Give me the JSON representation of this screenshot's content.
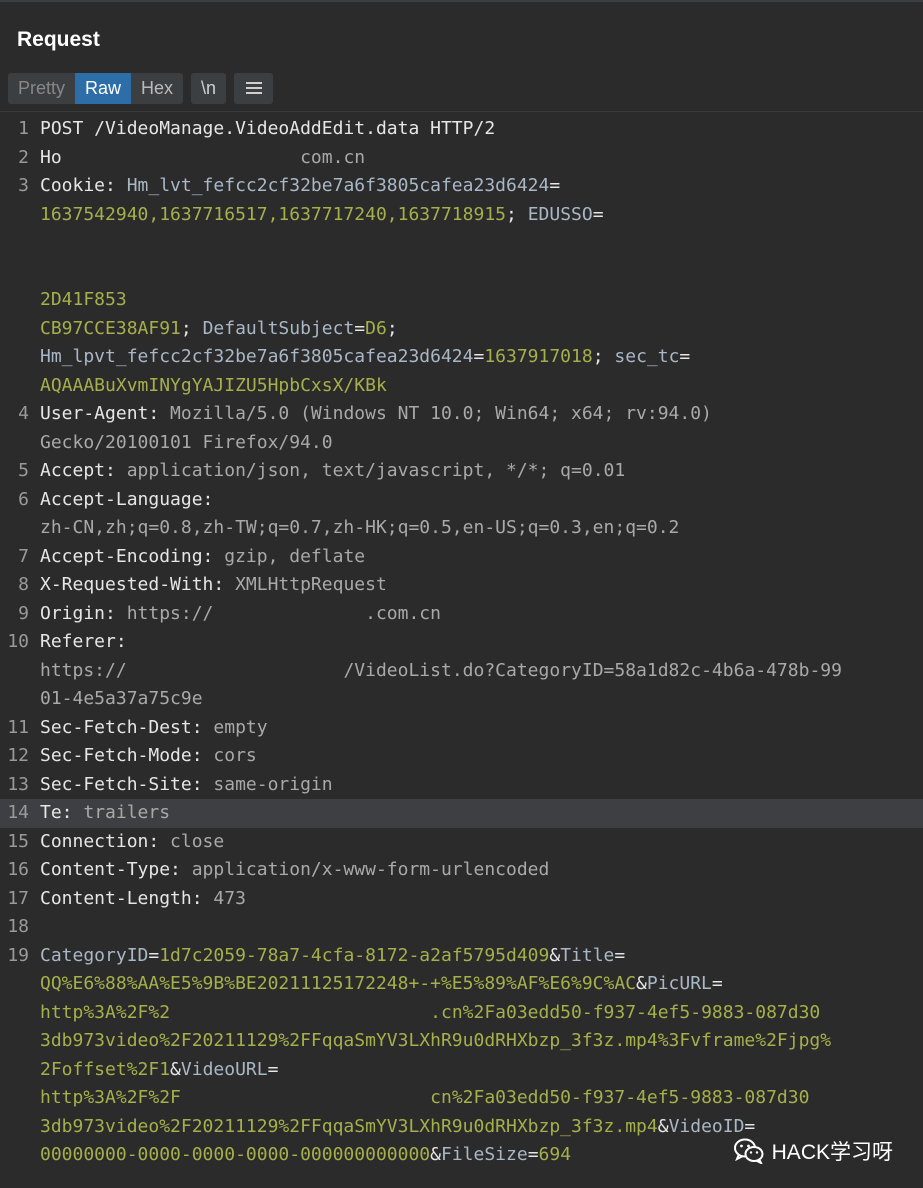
{
  "panel": {
    "title": "Request"
  },
  "toolbar": {
    "pretty_label": "Pretty",
    "raw_label": "Raw",
    "hex_label": "Hex",
    "newline_label": "\\n",
    "menu_icon": "hamburger-menu-icon"
  },
  "lines": [
    {
      "n": "1",
      "segs": [
        {
          "t": "POST /VideoManage.VideoAddEdit.data HTTP/2",
          "c": "k"
        }
      ]
    },
    {
      "n": "2",
      "segs": [
        {
          "t": "Ho",
          "c": "k"
        },
        {
          "t": "                      com.cn",
          "c": "v"
        }
      ]
    },
    {
      "n": "3",
      "segs": [
        {
          "t": "Cookie: ",
          "c": "k"
        },
        {
          "t": "Hm_lvt_fefcc2cf32be7a6f3805cafea23d6424",
          "c": "ck"
        },
        {
          "t": "=",
          "c": "k"
        }
      ]
    },
    {
      "n": "",
      "segs": [
        {
          "t": "1637542940,1637716517,1637717240,1637718915",
          "c": "cv"
        },
        {
          "t": "; ",
          "c": "k"
        },
        {
          "t": "EDUSSO",
          "c": "ck"
        },
        {
          "t": "=",
          "c": "k"
        }
      ]
    },
    {
      "n": "",
      "segs": [
        {
          "t": "",
          "c": "cv"
        }
      ]
    },
    {
      "n": "",
      "segs": [
        {
          "t": "",
          "c": "cv"
        }
      ]
    },
    {
      "n": "",
      "segs": [
        {
          "t": "2D41F853",
          "c": "cv"
        }
      ]
    },
    {
      "n": "",
      "segs": [
        {
          "t": "CB97CCE38AF91",
          "c": "cv"
        },
        {
          "t": "; ",
          "c": "k"
        },
        {
          "t": "DefaultSubject",
          "c": "ck"
        },
        {
          "t": "=",
          "c": "k"
        },
        {
          "t": "D6",
          "c": "cv"
        },
        {
          "t": ";",
          "c": "k"
        }
      ]
    },
    {
      "n": "",
      "segs": [
        {
          "t": "Hm_lpvt_fefcc2cf32be7a6f3805cafea23d6424",
          "c": "ck"
        },
        {
          "t": "=",
          "c": "k"
        },
        {
          "t": "1637917018",
          "c": "cv"
        },
        {
          "t": "; ",
          "c": "k"
        },
        {
          "t": "sec_tc",
          "c": "ck"
        },
        {
          "t": "=",
          "c": "k"
        }
      ]
    },
    {
      "n": "",
      "segs": [
        {
          "t": "AQAAABuXvmINYgYAJIZU5HpbCxsX/KBk",
          "c": "cv"
        }
      ]
    },
    {
      "n": "4",
      "segs": [
        {
          "t": "User-Agent: ",
          "c": "k"
        },
        {
          "t": "Mozilla/5.0 (Windows NT 10.0; Win64; x64; rv:94.0)",
          "c": "v"
        }
      ]
    },
    {
      "n": "",
      "segs": [
        {
          "t": "Gecko/20100101 Firefox/94.0",
          "c": "v"
        }
      ]
    },
    {
      "n": "5",
      "segs": [
        {
          "t": "Accept: ",
          "c": "k"
        },
        {
          "t": "application/json, text/javascript, */*; q=0.01",
          "c": "v"
        }
      ]
    },
    {
      "n": "6",
      "segs": [
        {
          "t": "Accept-Language: ",
          "c": "k"
        }
      ]
    },
    {
      "n": "",
      "segs": [
        {
          "t": "zh-CN,zh;q=0.8,zh-TW;q=0.7,zh-HK;q=0.5,en-US;q=0.3,en;q=0.2",
          "c": "v"
        }
      ]
    },
    {
      "n": "7",
      "segs": [
        {
          "t": "Accept-Encoding: ",
          "c": "k"
        },
        {
          "t": "gzip, deflate",
          "c": "v"
        }
      ]
    },
    {
      "n": "8",
      "segs": [
        {
          "t": "X-Requested-With: ",
          "c": "k"
        },
        {
          "t": "XMLHttpRequest",
          "c": "v"
        }
      ]
    },
    {
      "n": "9",
      "segs": [
        {
          "t": "Origin: ",
          "c": "k"
        },
        {
          "t": "https://",
          "c": "v"
        },
        {
          "t": "              ",
          "c": "v"
        },
        {
          "t": ".com.cn",
          "c": "v"
        }
      ]
    },
    {
      "n": "10",
      "segs": [
        {
          "t": "Referer: ",
          "c": "k"
        }
      ]
    },
    {
      "n": "",
      "segs": [
        {
          "t": "https://",
          "c": "v"
        },
        {
          "t": "                    ",
          "c": "v"
        },
        {
          "t": "/VideoList.do?CategoryID=58a1d82c-4b6a-478b-99",
          "c": "v"
        }
      ]
    },
    {
      "n": "",
      "segs": [
        {
          "t": "01-4e5a37a75c9e",
          "c": "v"
        }
      ]
    },
    {
      "n": "11",
      "segs": [
        {
          "t": "Sec-Fetch-Dest: ",
          "c": "k"
        },
        {
          "t": "empty",
          "c": "v"
        }
      ]
    },
    {
      "n": "12",
      "segs": [
        {
          "t": "Sec-Fetch-Mode: ",
          "c": "k"
        },
        {
          "t": "cors",
          "c": "v"
        }
      ]
    },
    {
      "n": "13",
      "segs": [
        {
          "t": "Sec-Fetch-Site: ",
          "c": "k"
        },
        {
          "t": "same-origin",
          "c": "v"
        }
      ]
    },
    {
      "n": "14",
      "hl": true,
      "segs": [
        {
          "t": "Te: ",
          "c": "k"
        },
        {
          "t": "trailers",
          "c": "v"
        }
      ]
    },
    {
      "n": "15",
      "segs": [
        {
          "t": "Connection: ",
          "c": "k"
        },
        {
          "t": "close",
          "c": "v"
        }
      ]
    },
    {
      "n": "16",
      "segs": [
        {
          "t": "Content-Type: ",
          "c": "k"
        },
        {
          "t": "application/x-www-form-urlencoded",
          "c": "v"
        }
      ]
    },
    {
      "n": "17",
      "segs": [
        {
          "t": "Content-Length: ",
          "c": "k"
        },
        {
          "t": "473",
          "c": "v"
        }
      ]
    },
    {
      "n": "18",
      "segs": [
        {
          "t": "",
          "c": "k"
        }
      ]
    },
    {
      "n": "19",
      "segs": [
        {
          "t": "CategoryID",
          "c": "ck"
        },
        {
          "t": "=",
          "c": "k"
        },
        {
          "t": "1d7c2059-78a7-4cfa-8172-a2af5795d409",
          "c": "cv"
        },
        {
          "t": "&",
          "c": "k"
        },
        {
          "t": "Title",
          "c": "ck"
        },
        {
          "t": "=",
          "c": "k"
        }
      ]
    },
    {
      "n": "",
      "segs": [
        {
          "t": "QQ%E6%88%AA%E5%9B%BE20211125172248+-+%E5%89%AF%E6%9C%AC",
          "c": "cv"
        },
        {
          "t": "&",
          "c": "k"
        },
        {
          "t": "PicURL",
          "c": "ck"
        },
        {
          "t": "=",
          "c": "k"
        }
      ]
    },
    {
      "n": "",
      "segs": [
        {
          "t": "http%3A%2F%2",
          "c": "cv"
        },
        {
          "t": "                        ",
          "c": "cv"
        },
        {
          "t": ".cn%2Fa03edd50-f937-4ef5-9883-087d30",
          "c": "cv"
        }
      ]
    },
    {
      "n": "",
      "segs": [
        {
          "t": "3db973video%2F20211129%2FFqqaSmYV3LXhR9u0dRHXbzp_3f3z.mp4%3Fvframe%2Fjpg%",
          "c": "cv"
        }
      ]
    },
    {
      "n": "",
      "segs": [
        {
          "t": "2Foffset%2F1",
          "c": "cv"
        },
        {
          "t": "&",
          "c": "k"
        },
        {
          "t": "VideoURL",
          "c": "ck"
        },
        {
          "t": "=",
          "c": "k"
        }
      ]
    },
    {
      "n": "",
      "segs": [
        {
          "t": "http%3A%2F%2F",
          "c": "cv"
        },
        {
          "t": "                       ",
          "c": "cv"
        },
        {
          "t": "cn%2Fa03edd50-f937-4ef5-9883-087d30",
          "c": "cv"
        }
      ]
    },
    {
      "n": "",
      "segs": [
        {
          "t": "3db973video%2F20211129%2FFqqaSmYV3LXhR9u0dRHXbzp_3f3z.mp4",
          "c": "cv"
        },
        {
          "t": "&",
          "c": "k"
        },
        {
          "t": "VideoID",
          "c": "ck"
        },
        {
          "t": "=",
          "c": "k"
        }
      ]
    },
    {
      "n": "",
      "segs": [
        {
          "t": "00000000-0000-0000-0000-000000000000",
          "c": "cv"
        },
        {
          "t": "&",
          "c": "k"
        },
        {
          "t": "FileSize",
          "c": "ck"
        },
        {
          "t": "=",
          "c": "k"
        },
        {
          "t": "694",
          "c": "cv"
        }
      ]
    }
  ],
  "watermark": {
    "text": "HACK学习呀",
    "icon": "wechat-icon"
  },
  "colors": {
    "background": "#2b2b2b",
    "active_tab": "#2e6ea8",
    "param_value": "#a6b04a",
    "param_name": "#a9b7c6"
  }
}
